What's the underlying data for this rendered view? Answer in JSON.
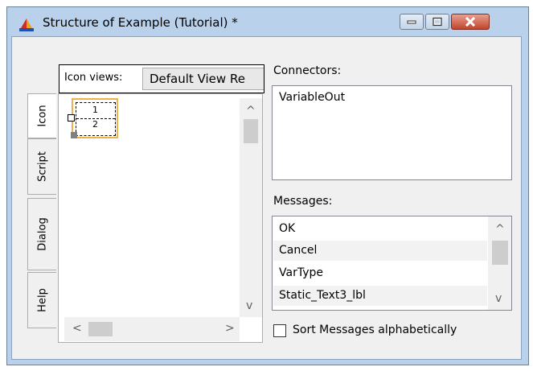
{
  "window": {
    "title": "Structure of Example (Tutorial) *",
    "app_icon": "structure-app-icon",
    "caption_buttons": [
      {
        "name": "minimize-icon",
        "glyph": "▭"
      },
      {
        "name": "maximize-icon",
        "glyph": "◻"
      },
      {
        "name": "close-icon",
        "glyph": "✕"
      }
    ]
  },
  "tabs": [
    {
      "label": "Icon",
      "active": true
    },
    {
      "label": "Script",
      "active": false
    },
    {
      "label": "Dialog",
      "active": false
    },
    {
      "label": "Help",
      "active": false
    }
  ],
  "icon_views": {
    "label": "Icon views:",
    "selected": "Default View  Re"
  },
  "symbol": {
    "top": "1",
    "bottom": "2"
  },
  "scroll": {
    "up": "^",
    "down": "v",
    "left": "<",
    "right": ">"
  },
  "connectors": {
    "label": "Connectors:",
    "items": [
      "VariableOut"
    ]
  },
  "messages": {
    "label": "Messages:",
    "items": [
      "OK",
      "Cancel",
      "VarType",
      "Static_Text3_lbl"
    ],
    "up": "^",
    "down": "v"
  },
  "sort_checkbox": {
    "label": "Sort Messages alphabetically",
    "checked": false
  }
}
